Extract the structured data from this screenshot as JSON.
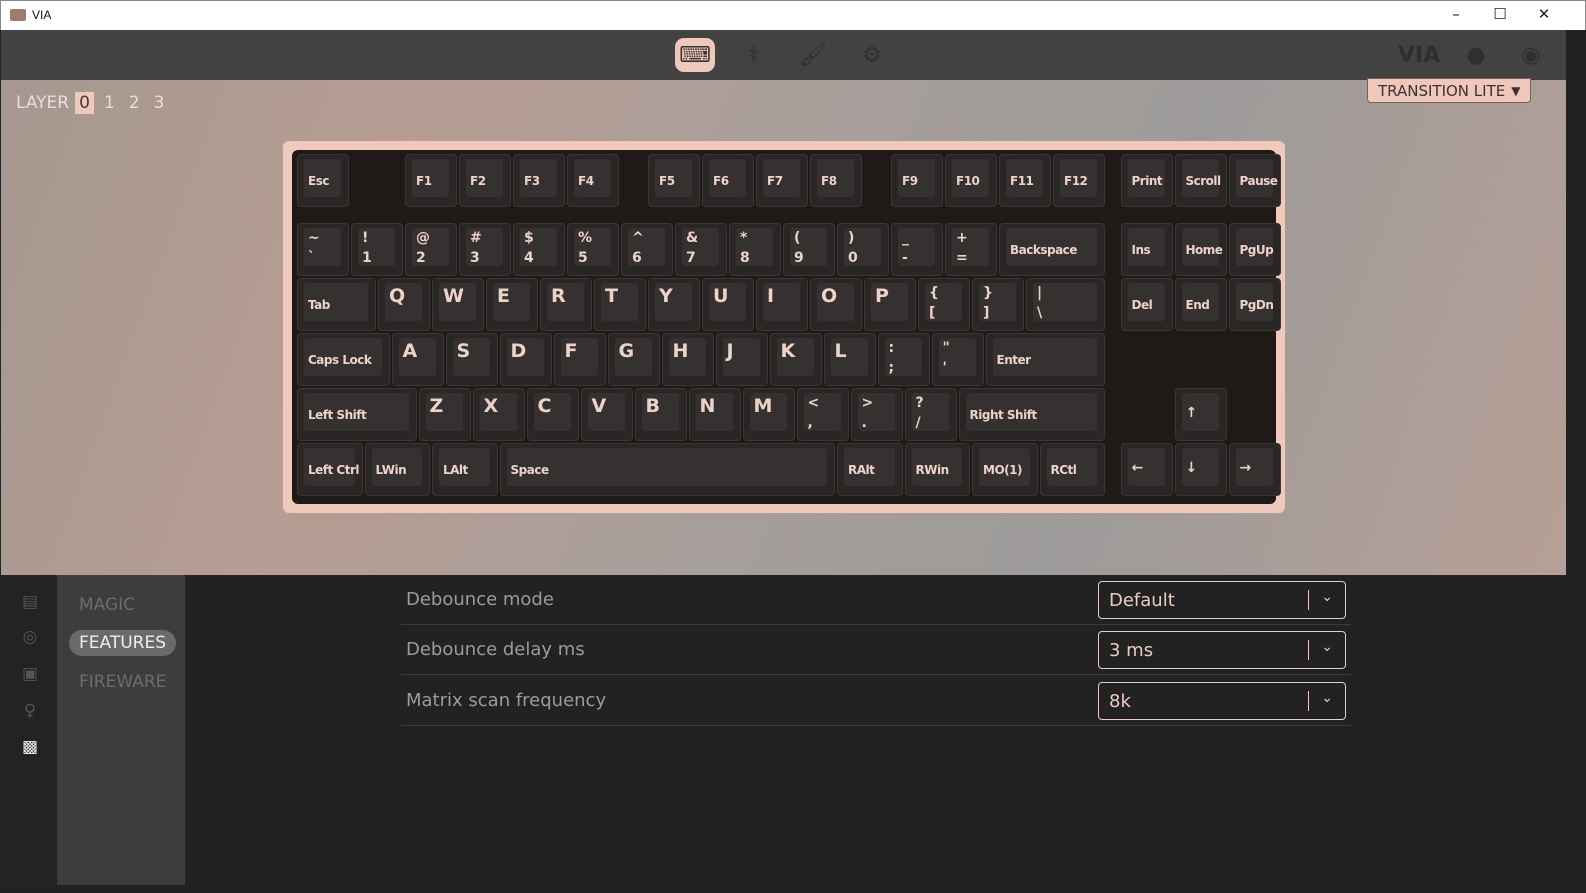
{
  "window": {
    "title": "VIA"
  },
  "nav": {
    "icons": [
      "keyboard-icon",
      "stethoscope-icon",
      "paintbrush-icon",
      "gear-icon"
    ],
    "brand": "VIA"
  },
  "layer": {
    "label": "LAYER",
    "layers": [
      "0",
      "1",
      "2",
      "3"
    ],
    "selected": "0"
  },
  "keyboard": {
    "name": "TRANSITION LITE",
    "keys": [
      "Esc",
      "F1",
      "F2",
      "F3",
      "F4",
      "F5",
      "F6",
      "F7",
      "F8",
      "F9",
      "F10",
      "F11",
      "F12",
      "Print",
      "Scroll",
      "Pause",
      "~\n`",
      "!\n1",
      "@\n2",
      "#\n3",
      "$\n4",
      "%\n5",
      "^\n6",
      "&\n7",
      "*\n8",
      "(\n9",
      ")\n0",
      "_\n-",
      "+\n=",
      "Backspace",
      "Ins",
      "Home",
      "PgUp",
      "Tab",
      "Q",
      "W",
      "E",
      "R",
      "T",
      "Y",
      "U",
      "I",
      "O",
      "P",
      "{\n[",
      "}\n]",
      "|\n\\",
      "Del",
      "End",
      "PgDn",
      "Caps Lock",
      "A",
      "S",
      "D",
      "F",
      "G",
      "H",
      "J",
      "K",
      "L",
      ":\n;",
      "\"\n'",
      "Enter",
      "Left Shift",
      "Z",
      "X",
      "C",
      "V",
      "B",
      "N",
      "M",
      "<\n,",
      ">\n.",
      "?\n/",
      "Right Shift",
      "↑",
      "Left Ctrl",
      "LWin",
      "LAlt",
      "Space",
      "RAlt",
      "RWin",
      "MO(1)",
      "RCtl",
      "←",
      "↓",
      "→"
    ]
  },
  "sidebar": {
    "menu": [
      "MAGIC",
      "FEATURES",
      "FIREWARE"
    ],
    "selected": "FEATURES"
  },
  "settings": [
    {
      "label": "Debounce mode",
      "value": "Default"
    },
    {
      "label": "Debounce delay ms",
      "value": "3 ms"
    },
    {
      "label": "Matrix scan frequency",
      "value": "8k"
    }
  ],
  "colors": {
    "accent": "#f0c8bb",
    "panel": "#222222"
  }
}
